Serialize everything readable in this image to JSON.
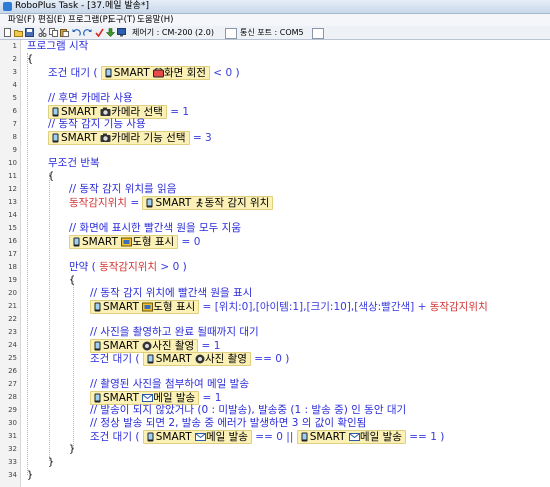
{
  "window": {
    "title": "RoboPlus Task - [37.메일 발송*]"
  },
  "menu": [
    {
      "label": "파일(F)"
    },
    {
      "label": "편집(E)"
    },
    {
      "label": "프로그램(P)"
    },
    {
      "label": "도구(T)"
    },
    {
      "label": "도움말(H)"
    }
  ],
  "toolbar": {
    "controller_label": "제어기 : CM-200 (2.0)",
    "port_label": "통신 포트 : COM5"
  },
  "device": "SMART",
  "lines": [
    {
      "n": "1",
      "text": "프로그램 시작"
    },
    {
      "n": "2",
      "text": "{"
    },
    {
      "n": "3",
      "k": "조건 대기 (",
      "dev": "화면 회전",
      "op": "<",
      "val": "0",
      "close": ")"
    },
    {
      "n": "4"
    },
    {
      "n": "5",
      "text": "// 후면 카메라 사용"
    },
    {
      "n": "6",
      "dev": "카메라 선택",
      "op": "=",
      "val": "1"
    },
    {
      "n": "7",
      "text": "// 동작 감지 기능 사용"
    },
    {
      "n": "8",
      "dev": "카메라 기능 선택",
      "op": "=",
      "val": "3"
    },
    {
      "n": "9"
    },
    {
      "n": "10",
      "text": "무조건 반복"
    },
    {
      "n": "11",
      "text": "{"
    },
    {
      "n": "12",
      "text": "// 동작 감지 위치를 읽음"
    },
    {
      "n": "13",
      "var": "동작감지위치",
      "op": "=",
      "dev": "동작 감지 위치"
    },
    {
      "n": "14"
    },
    {
      "n": "15",
      "text": "// 화면에 표시한 빨간색 원을 모두 지움"
    },
    {
      "n": "16",
      "dev": "도형 표시",
      "op": "=",
      "val": "0"
    },
    {
      "n": "17"
    },
    {
      "n": "18",
      "k": "만약 (",
      "var": "동작감지위치",
      "op": ">",
      "val": "0",
      "close": ")"
    },
    {
      "n": "19",
      "text": "{"
    },
    {
      "n": "20",
      "text": "// 동작 감지 위치에 빨간색 원을 표시"
    },
    {
      "n": "21",
      "dev": "도형 표시",
      "op": "=",
      "val": "[위치:0],[아이템:1],[크기:10],[색상:빨간색]",
      "op2": "+",
      "var": "동작감지위치"
    },
    {
      "n": "22"
    },
    {
      "n": "23",
      "text": "// 사진을 촬영하고 완료 될때까지 대기"
    },
    {
      "n": "24",
      "dev": "사진 촬영",
      "op": "=",
      "val": "1"
    },
    {
      "n": "25",
      "k": "조건 대기 (",
      "dev": "사진 촬영",
      "op": "==",
      "val": "0",
      "close": ")"
    },
    {
      "n": "26"
    },
    {
      "n": "27",
      "text": "// 촬영된 사진을 첨부하여 메일 발송"
    },
    {
      "n": "28",
      "dev": "메일 발송",
      "op": "=",
      "val": "1"
    },
    {
      "n": "29",
      "text": "// 발송이 되지 않았거나 (0 : 미발송), 발송중 (1 : 발송 중) 인 동안 대기"
    },
    {
      "n": "30",
      "text": "// 정상 발송 되면 2, 발송 중 에러가 발생하면 3 의 값이 확인됨"
    },
    {
      "n": "31",
      "k": "조건 대기 (",
      "dev": "메일 발송",
      "op": "==",
      "val": "0",
      "op2": "||",
      "dev2": "메일 발송",
      "op3": "==",
      "val2": "1",
      "close": ")"
    },
    {
      "n": "32",
      "text": "}"
    },
    {
      "n": "33",
      "text": "}"
    },
    {
      "n": "34",
      "text": "}"
    }
  ]
}
